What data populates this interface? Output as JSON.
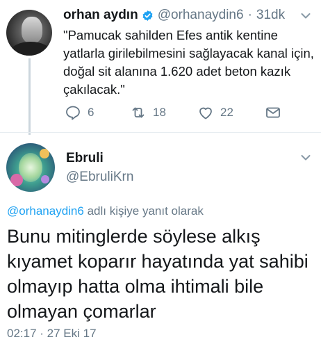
{
  "parent_tweet": {
    "name": "orhan aydın",
    "handle": "@orhanaydin6",
    "separator": "·",
    "age": "31dk",
    "text": "\"Pamucak sahilden Efes antik kentine yatlarla girilebilmesini sağlayacak kanal için, doğal sit alanına 1.620 adet beton kazık çakılacak.\"",
    "actions": {
      "reply_count": "6",
      "retweet_count": "18",
      "like_count": "22"
    }
  },
  "reply_tweet": {
    "name": "Ebruli",
    "handle": "@EbruliKrn",
    "reply_mention": "@orhanaydin6",
    "reply_suffix": "adlı kişiye yanıt olarak",
    "text": "Bunu mitinglerde söylese alkış kıyamet koparır hayatında yat sahibi olmayıp hatta olma ihtimali bile olmayan çomarlar",
    "timestamp": "02:17 · 27 Eki 17"
  },
  "colors": {
    "accent": "#1da1f2",
    "muted": "#657786",
    "text": "#14171a",
    "thread_line": "#ccd6dd"
  },
  "icons": [
    "verified-badge-icon",
    "chevron-down-icon",
    "reply-icon",
    "retweet-icon",
    "like-icon",
    "direct-message-icon"
  ]
}
